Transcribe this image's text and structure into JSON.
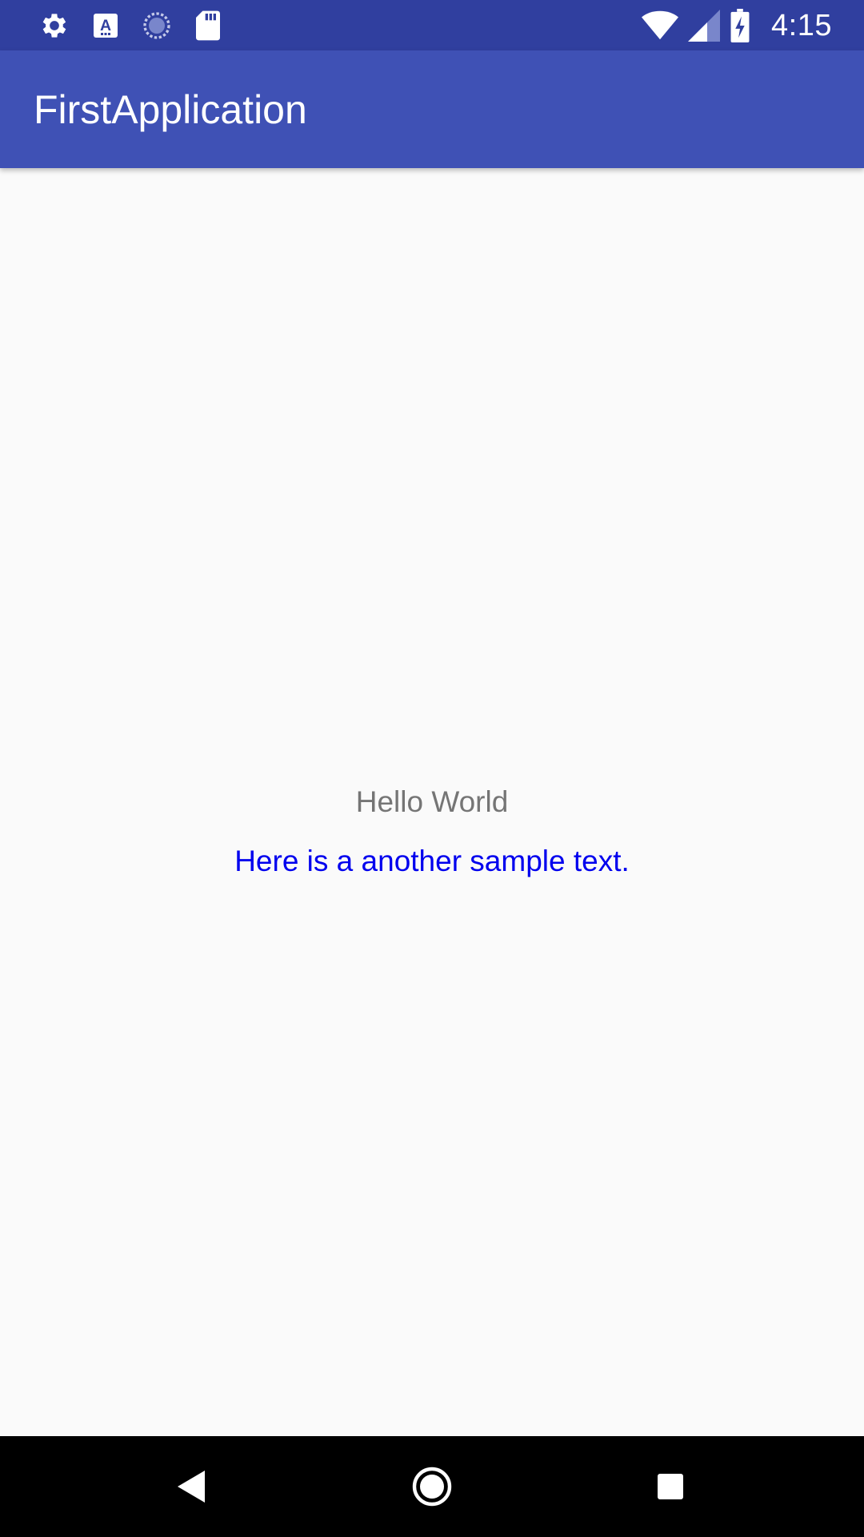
{
  "status_bar": {
    "time": "4:15",
    "background": "#303f9f",
    "left_icons": [
      "gear-icon",
      "font-a-icon",
      "sync-progress-icon",
      "sd-card-icon"
    ],
    "right_icons": [
      "wifi-icon",
      "cell-signal-icon",
      "battery-charging-icon"
    ]
  },
  "app_bar": {
    "title": "FirstApplication",
    "background": "#3f51b5"
  },
  "main": {
    "hello_text": "Hello World",
    "sample_text": "Here is a another sample text.",
    "sample_text_color": "#0000ee",
    "hello_text_color": "#757575"
  },
  "nav_bar": {
    "buttons": [
      "back-icon",
      "home-icon",
      "recent-apps-icon"
    ]
  }
}
